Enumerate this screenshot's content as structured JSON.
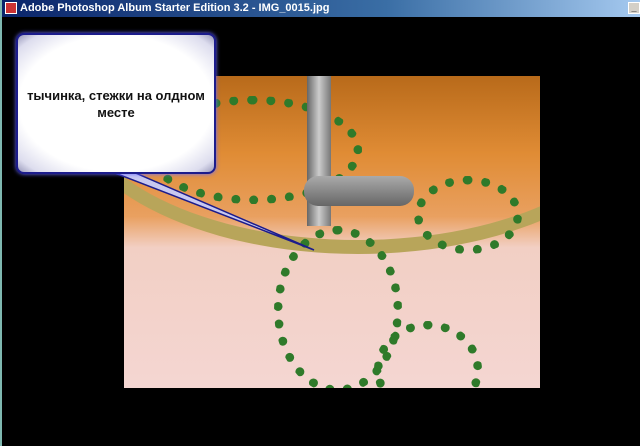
{
  "window": {
    "title": "Adobe Photoshop Album Starter Edition 3.2 - IMG_0015.jpg",
    "minimize_label": "_"
  },
  "callout": {
    "text": "тычинка, стежки на олдном месте"
  }
}
